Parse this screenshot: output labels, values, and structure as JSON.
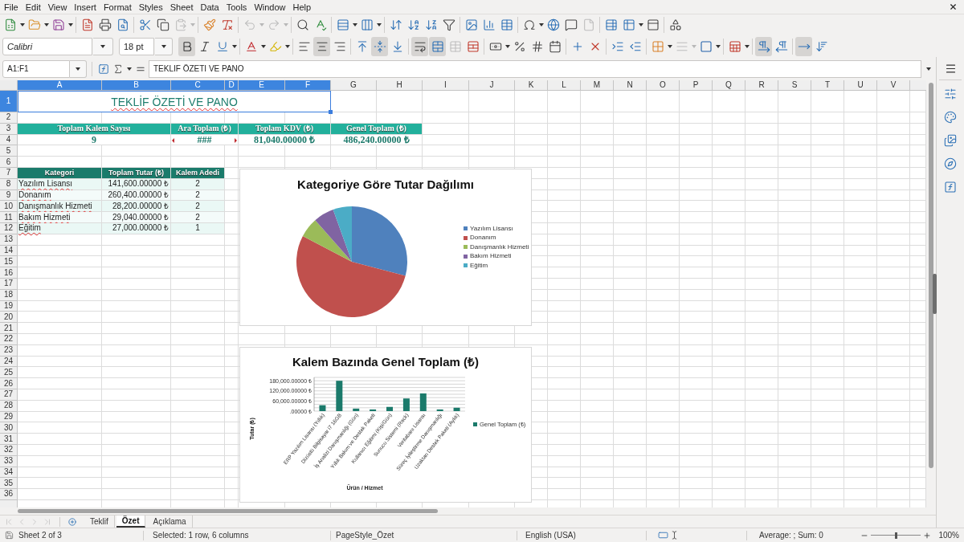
{
  "menu_bar": {
    "items": [
      "File",
      "Edit",
      "View",
      "Insert",
      "Format",
      "Styles",
      "Sheet",
      "Data",
      "Tools",
      "Window",
      "Help"
    ]
  },
  "standard_toolbar": [
    {
      "kind": "new",
      "disabled": false
    },
    {
      "kind": "dropdown",
      "disabled": false
    },
    {
      "kind": "open",
      "disabled": false
    },
    {
      "kind": "dropdown",
      "disabled": false
    },
    {
      "kind": "save",
      "disabled": false
    },
    {
      "kind": "dropdown",
      "disabled": false
    },
    {
      "kind": "separator"
    },
    {
      "kind": "export_pdf",
      "disabled": false
    },
    {
      "kind": "print",
      "disabled": false
    },
    {
      "kind": "print_preview",
      "disabled": false
    },
    {
      "kind": "separator"
    },
    {
      "kind": "cut",
      "disabled": false
    },
    {
      "kind": "copy",
      "disabled": false
    },
    {
      "kind": "paste",
      "disabled": true
    },
    {
      "kind": "dropdown",
      "disabled": true
    },
    {
      "kind": "separator"
    },
    {
      "kind": "clone_formatting",
      "disabled": false
    },
    {
      "kind": "clear_formatting",
      "disabled": false
    },
    {
      "kind": "separator"
    },
    {
      "kind": "undo",
      "disabled": true
    },
    {
      "kind": "dropdown",
      "disabled": true
    },
    {
      "kind": "redo",
      "disabled": true
    },
    {
      "kind": "dropdown",
      "disabled": true
    },
    {
      "kind": "separator"
    },
    {
      "kind": "find_replace",
      "disabled": false
    },
    {
      "kind": "spelling",
      "disabled": false
    },
    {
      "kind": "separator"
    },
    {
      "kind": "row",
      "disabled": false
    },
    {
      "kind": "dropdown",
      "disabled": false
    },
    {
      "kind": "column",
      "disabled": false
    },
    {
      "kind": "dropdown",
      "disabled": false
    },
    {
      "kind": "separator"
    },
    {
      "kind": "sort",
      "disabled": false
    },
    {
      "kind": "sort_ascending",
      "disabled": false
    },
    {
      "kind": "sort_descending",
      "disabled": false
    },
    {
      "kind": "autofilter",
      "disabled": false
    },
    {
      "kind": "separator"
    },
    {
      "kind": "image",
      "disabled": false
    },
    {
      "kind": "chart",
      "disabled": false
    },
    {
      "kind": "pivot_table",
      "disabled": false
    },
    {
      "kind": "separator"
    },
    {
      "kind": "special_character",
      "disabled": false
    },
    {
      "kind": "dropdown",
      "disabled": false
    },
    {
      "kind": "hyperlink",
      "disabled": false
    },
    {
      "kind": "comment",
      "disabled": false
    },
    {
      "kind": "header_footer",
      "disabled": true
    },
    {
      "kind": "separator"
    },
    {
      "kind": "print_area",
      "disabled": false
    },
    {
      "kind": "freeze",
      "disabled": false
    },
    {
      "kind": "dropdown",
      "disabled": false
    },
    {
      "kind": "split",
      "disabled": false
    },
    {
      "kind": "separator"
    },
    {
      "kind": "draw",
      "disabled": false
    }
  ],
  "formatting_toolbar": {
    "font_name": "Calibri",
    "font_size": "18 pt",
    "items": [
      {
        "kind": "bold",
        "on": true,
        "disabled": false
      },
      {
        "kind": "italic",
        "on": false,
        "disabled": false
      },
      {
        "kind": "underline",
        "on": false,
        "disabled": false
      },
      {
        "kind": "dropdown",
        "on": false,
        "disabled": false
      },
      {
        "kind": "separator"
      },
      {
        "kind": "font_color",
        "on": false,
        "disabled": false
      },
      {
        "kind": "dropdown",
        "on": false,
        "disabled": false
      },
      {
        "kind": "highlight",
        "on": false,
        "disabled": false
      },
      {
        "kind": "dropdown",
        "on": false,
        "disabled": false
      },
      {
        "kind": "separator"
      },
      {
        "kind": "align_left",
        "on": false,
        "disabled": false
      },
      {
        "kind": "align_center",
        "on": true,
        "disabled": false
      },
      {
        "kind": "align_right",
        "on": false,
        "disabled": false
      },
      {
        "kind": "separator"
      },
      {
        "kind": "align_top",
        "on": false,
        "disabled": false
      },
      {
        "kind": "align_middle",
        "on": true,
        "disabled": false
      },
      {
        "kind": "align_bottom",
        "on": false,
        "disabled": false
      },
      {
        "kind": "separator"
      },
      {
        "kind": "wrap",
        "on": true,
        "disabled": false
      },
      {
        "kind": "merge_center",
        "on": true,
        "disabled": false
      },
      {
        "kind": "merge",
        "on": false,
        "disabled": true
      },
      {
        "kind": "unmerge",
        "on": false,
        "disabled": false
      },
      {
        "kind": "separator"
      },
      {
        "kind": "currency",
        "on": false,
        "disabled": false
      },
      {
        "kind": "dropdown",
        "on": false,
        "disabled": false
      },
      {
        "kind": "percent",
        "on": false,
        "disabled": false
      },
      {
        "kind": "number",
        "on": false,
        "disabled": false
      },
      {
        "kind": "date",
        "on": false,
        "disabled": false
      },
      {
        "kind": "separator"
      },
      {
        "kind": "add_decimal",
        "on": false,
        "disabled": false
      },
      {
        "kind": "delete_decimal",
        "on": false,
        "disabled": false
      },
      {
        "kind": "separator"
      },
      {
        "kind": "indent_increase",
        "on": false,
        "disabled": false
      },
      {
        "kind": "indent_decrease",
        "on": false,
        "disabled": false
      },
      {
        "kind": "separator"
      },
      {
        "kind": "borders",
        "on": false,
        "disabled": false
      },
      {
        "kind": "dropdown",
        "on": false,
        "disabled": false
      },
      {
        "kind": "border_style",
        "on": false,
        "disabled": true
      },
      {
        "kind": "dropdown",
        "on": false,
        "disabled": true
      },
      {
        "kind": "border_color",
        "on": false,
        "disabled": false
      },
      {
        "kind": "dropdown",
        "on": false,
        "disabled": false
      },
      {
        "kind": "separator"
      },
      {
        "kind": "conditional",
        "on": false,
        "disabled": false
      },
      {
        "kind": "dropdown",
        "on": false,
        "disabled": false
      },
      {
        "kind": "separator"
      },
      {
        "kind": "ltr",
        "on": true,
        "disabled": false
      },
      {
        "kind": "rtl",
        "on": false,
        "disabled": false
      },
      {
        "kind": "separator"
      },
      {
        "kind": "text_ltr",
        "on": true,
        "disabled": false
      },
      {
        "kind": "text_ttb",
        "on": false,
        "disabled": false
      }
    ]
  },
  "formula_bar": {
    "name_box": "A1:F1",
    "formula": "TEKLİF ÖZETİ VE PANO"
  },
  "sheet": {
    "columns": [
      {
        "label": "A",
        "selected": true
      },
      {
        "label": "B",
        "selected": true
      },
      {
        "label": "C",
        "selected": true
      },
      {
        "label": "D",
        "selected": true
      },
      {
        "label": "E",
        "selected": true
      },
      {
        "label": "F",
        "selected": true
      },
      {
        "label": "G",
        "selected": false
      },
      {
        "label": "H",
        "selected": false
      },
      {
        "label": "I",
        "selected": false
      },
      {
        "label": "J",
        "selected": false
      },
      {
        "label": "K",
        "selected": false
      },
      {
        "label": "L",
        "selected": false
      },
      {
        "label": "M",
        "selected": false
      },
      {
        "label": "N",
        "selected": false
      },
      {
        "label": "O",
        "selected": false
      },
      {
        "label": "P",
        "selected": false
      },
      {
        "label": "Q",
        "selected": false
      },
      {
        "label": "R",
        "selected": false
      },
      {
        "label": "S",
        "selected": false
      },
      {
        "label": "T",
        "selected": false
      },
      {
        "label": "U",
        "selected": false
      },
      {
        "label": "V",
        "selected": false
      }
    ],
    "rows": [
      {
        "label": "1",
        "selected": true
      },
      {
        "label": "2",
        "selected": false
      },
      {
        "label": "3",
        "selected": false
      },
      {
        "label": "4",
        "selected": false
      },
      {
        "label": "5",
        "selected": false
      },
      {
        "label": "6",
        "selected": false
      },
      {
        "label": "7",
        "selected": false
      },
      {
        "label": "8",
        "selected": false
      },
      {
        "label": "9",
        "selected": false
      },
      {
        "label": "10",
        "selected": false
      },
      {
        "label": "11",
        "selected": false
      },
      {
        "label": "12",
        "selected": false
      },
      {
        "label": "13",
        "selected": false
      },
      {
        "label": "14",
        "selected": false
      },
      {
        "label": "15",
        "selected": false
      },
      {
        "label": "16",
        "selected": false
      },
      {
        "label": "17",
        "selected": false
      },
      {
        "label": "18",
        "selected": false
      },
      {
        "label": "19",
        "selected": false
      },
      {
        "label": "20",
        "selected": false
      },
      {
        "label": "21",
        "selected": false
      },
      {
        "label": "22",
        "selected": false
      },
      {
        "label": "23",
        "selected": false
      },
      {
        "label": "24",
        "selected": false
      },
      {
        "label": "25",
        "selected": false
      },
      {
        "label": "26",
        "selected": false
      },
      {
        "label": "27",
        "selected": false
      },
      {
        "label": "28",
        "selected": false
      },
      {
        "label": "29",
        "selected": false
      },
      {
        "label": "30",
        "selected": false
      },
      {
        "label": "31",
        "selected": false
      },
      {
        "label": "32",
        "selected": false
      },
      {
        "label": "33",
        "selected": false
      },
      {
        "label": "34",
        "selected": false
      },
      {
        "label": "35",
        "selected": false
      },
      {
        "label": "36",
        "selected": false
      }
    ],
    "title": {
      "text": "TEKLİF ÖZETİ VE PANO",
      "selected": true,
      "spell_error": true
    },
    "summary": [
      {
        "label": "Toplam Kalem Sayısı",
        "value": "9",
        "overflow": false
      },
      {
        "label": "Ara Toplam (₺)",
        "value": "###",
        "overflow": true
      },
      {
        "label": "Toplam KDV (₺)",
        "value": "81,040.00000 ₺",
        "overflow": false
      },
      {
        "label": "Genel Toplam (₺)",
        "value": "486,240.00000 ₺",
        "overflow": false
      }
    ],
    "category_table": {
      "columns": [
        "Kategori",
        "Toplam Tutar (₺)",
        "Kalem Adedi"
      ],
      "rows": [
        {
          "category": "Yazılım Lisansı",
          "spell_error": true,
          "total": "141,600.00000 ₺",
          "count": "2"
        },
        {
          "category": "Donanım",
          "spell_error": true,
          "total": "260,400.00000 ₺",
          "count": "2"
        },
        {
          "category": "Danışmanlık Hizmeti",
          "spell_error": true,
          "total": "28,200.00000 ₺",
          "count": "2"
        },
        {
          "category": "Bakım Hizmeti",
          "spell_error": true,
          "total": "29,040.00000 ₺",
          "count": "2"
        },
        {
          "category": "Eğitim",
          "spell_error": true,
          "total": "27,000.00000 ₺",
          "count": "1"
        }
      ]
    }
  },
  "pie_chart": {
    "chart_data": {
      "type": "pie",
      "title": "Kategoriye Göre Tutar Dağılımı",
      "categories": [
        "Yazılım Lisansı",
        "Donanım",
        "Danışmanlık Hizmeti",
        "Bakım Hizmeti",
        "Eğitim"
      ],
      "values": [
        29.1,
        53.6,
        5.8,
        6.0,
        5.5
      ],
      "colors": [
        "#4f81bd",
        "#c0504d",
        "#9bbb59",
        "#8064a2",
        "#4bacc6"
      ],
      "legend": "right"
    }
  },
  "bar_chart": {
    "chart_data": {
      "type": "bar",
      "title": "Kalem Bazında Genel Toplam (₺)",
      "xlabel": "Ürün / Hizmet",
      "ylabel": "Tutar (₺)",
      "categories": [
        "ERP Yazılım Lisansı (Yıllık)",
        "Dizüstü Bilgisayar i7 16GB",
        "İş Analizi Danışmanlığı (Gün)",
        "Yıllık Bakım ve Destek Paketi",
        "Kullanıcı Eğitimi (Kişi/Gün)",
        "Sunucu Sistemi (Rack)",
        "Veritabanı Lisansı",
        "Süreç İyileştirme Danışmanlığı",
        "Uzaktan Destek Paketi (Aylık)"
      ],
      "series": [
        {
          "name": "Genel Toplam (₺)",
          "color": "#1b7a6b",
          "values": [
            35000,
            180000,
            15000,
            10000,
            25000,
            75000,
            105000,
            10000,
            20000
          ]
        }
      ],
      "ylim": [
        0,
        200000
      ],
      "yticks": [
        {
          "value": 0,
          "label": ".00000 ₺"
        },
        {
          "value": 60000,
          "label": "60,000.00000 ₺"
        },
        {
          "value": 120000,
          "label": "120,000.00000 ₺"
        },
        {
          "value": 180000,
          "label": "180,000.00000 ₺"
        }
      ],
      "grid": true,
      "legend": "right"
    }
  },
  "sheet_tabs": {
    "navigation": [
      {
        "kind": "first",
        "disabled": true
      },
      {
        "kind": "previous",
        "disabled": true
      },
      {
        "kind": "next",
        "disabled": true
      },
      {
        "kind": "last",
        "disabled": true
      }
    ],
    "tabs": [
      {
        "label": "Teklif",
        "selected": false
      },
      {
        "label": "Özet",
        "selected": true
      },
      {
        "label": "Açıklama",
        "selected": false
      }
    ]
  },
  "status_bar": {
    "sheet": "Sheet 2 of 3",
    "selection": "Selected: 1 row, 6 columns",
    "page_style": "PageStyle_Özet",
    "language": "English (USA)",
    "summary": "Average: ; Sum: 0",
    "zoom_slider": {
      "level": 0.5
    },
    "zoom": "100%"
  }
}
